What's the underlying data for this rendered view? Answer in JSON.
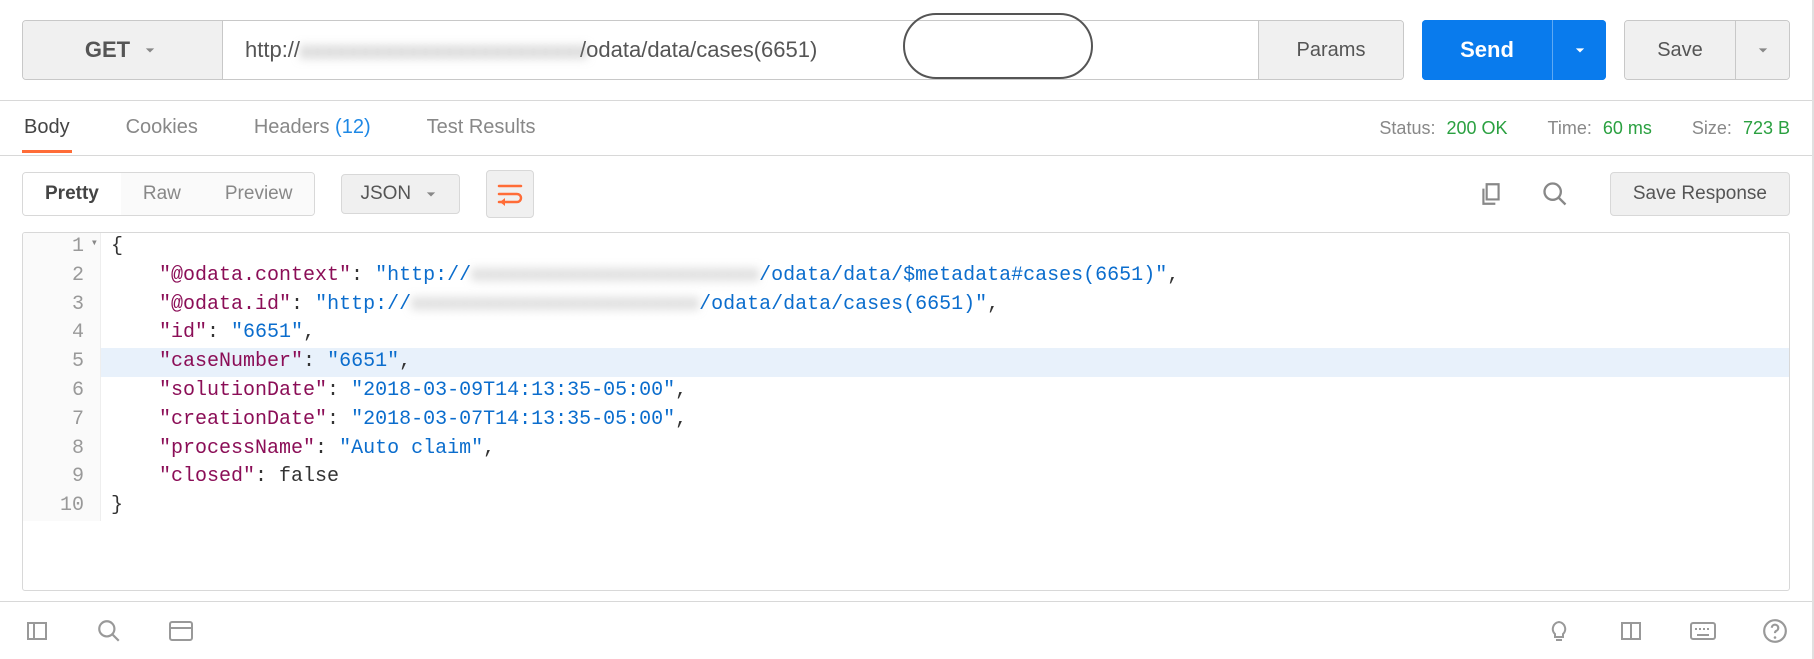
{
  "request": {
    "method": "GET",
    "url_prefix": "http://",
    "url_blur": "xxxxxxxxxxxxxxxxxxxxxxxx",
    "url_tail": "/odata/data/cases(6651)",
    "params_label": "Params",
    "send_label": "Send",
    "save_label": "Save"
  },
  "tabs": {
    "body": "Body",
    "cookies": "Cookies",
    "headers": "Headers",
    "headers_count": "(12)",
    "test_results": "Test Results"
  },
  "status": {
    "status_label": "Status:",
    "status_value": "200 OK",
    "time_label": "Time:",
    "time_value": "60 ms",
    "size_label": "Size:",
    "size_value": "723 B"
  },
  "body_toolbar": {
    "pretty": "Pretty",
    "raw": "Raw",
    "preview": "Preview",
    "format": "JSON",
    "save_response": "Save Response"
  },
  "response_json": {
    "lines": [
      {
        "n": 1,
        "fold": true,
        "segments": [
          [
            "plain",
            "{"
          ]
        ]
      },
      {
        "n": 2,
        "segments": [
          [
            "indent",
            "    "
          ],
          [
            "key",
            "\"@odata.context\""
          ],
          [
            "plain",
            ": "
          ],
          [
            "str",
            "\"http://"
          ],
          [
            "blur",
            "xxxxxxxxxxxxxxxxxxxxxxxx"
          ],
          [
            "str",
            "/odata/data/$metadata#cases(6651)\""
          ],
          [
            "plain",
            ","
          ]
        ]
      },
      {
        "n": 3,
        "segments": [
          [
            "indent",
            "    "
          ],
          [
            "key",
            "\"@odata.id\""
          ],
          [
            "plain",
            ": "
          ],
          [
            "str",
            "\"http://"
          ],
          [
            "blur",
            "xxxxxxxxxxxxxxxxxxxxxxxx"
          ],
          [
            "str",
            "/odata/data/cases(6651)\""
          ],
          [
            "plain",
            ","
          ]
        ]
      },
      {
        "n": 4,
        "segments": [
          [
            "indent",
            "    "
          ],
          [
            "key",
            "\"id\""
          ],
          [
            "plain",
            ": "
          ],
          [
            "str",
            "\"6651\""
          ],
          [
            "plain",
            ","
          ]
        ]
      },
      {
        "n": 5,
        "selected": true,
        "segments": [
          [
            "indent",
            "    "
          ],
          [
            "key",
            "\"caseNumber\""
          ],
          [
            "plain",
            ": "
          ],
          [
            "str",
            "\"6651\""
          ],
          [
            "plain",
            ","
          ]
        ]
      },
      {
        "n": 6,
        "segments": [
          [
            "indent",
            "    "
          ],
          [
            "key",
            "\"solutionDate\""
          ],
          [
            "plain",
            ": "
          ],
          [
            "str",
            "\"2018-03-09T14:13:35-05:00\""
          ],
          [
            "plain",
            ","
          ]
        ]
      },
      {
        "n": 7,
        "segments": [
          [
            "indent",
            "    "
          ],
          [
            "key",
            "\"creationDate\""
          ],
          [
            "plain",
            ": "
          ],
          [
            "str",
            "\"2018-03-07T14:13:35-05:00\""
          ],
          [
            "plain",
            ","
          ]
        ]
      },
      {
        "n": 8,
        "segments": [
          [
            "indent",
            "    "
          ],
          [
            "key",
            "\"processName\""
          ],
          [
            "plain",
            ": "
          ],
          [
            "str",
            "\"Auto claim\""
          ],
          [
            "plain",
            ","
          ]
        ]
      },
      {
        "n": 9,
        "segments": [
          [
            "indent",
            "    "
          ],
          [
            "key",
            "\"closed\""
          ],
          [
            "plain",
            ": "
          ],
          [
            "plain",
            "false"
          ]
        ]
      },
      {
        "n": 10,
        "segments": [
          [
            "plain",
            "}"
          ]
        ]
      }
    ]
  }
}
